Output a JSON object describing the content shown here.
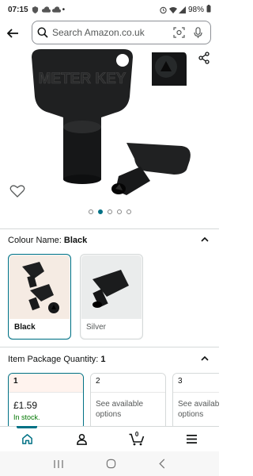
{
  "status": {
    "time": "07:15",
    "battery": "98%"
  },
  "search": {
    "placeholder": "Search Amazon.co.uk"
  },
  "gallery": {
    "image_count": 5,
    "active_index": 1,
    "product_text": "METER KEY"
  },
  "colour": {
    "label": "Colour Name:",
    "selected": "Black",
    "options": [
      {
        "label": "Black",
        "selected": true
      },
      {
        "label": "Silver",
        "selected": false
      }
    ]
  },
  "package": {
    "label": "Item Package Quantity:",
    "selected": "1",
    "options": [
      {
        "num": "1",
        "price": "£1.59",
        "stock": "In stock.",
        "selected": true
      },
      {
        "num": "2",
        "note": "See available options",
        "selected": false
      },
      {
        "num": "3",
        "note": "See available options",
        "selected": false
      }
    ]
  },
  "bottom_nav": {
    "cart_count": "0"
  },
  "colors": {
    "accent": "#007185",
    "stock": "#007600",
    "highlight": "#fff3ee"
  }
}
